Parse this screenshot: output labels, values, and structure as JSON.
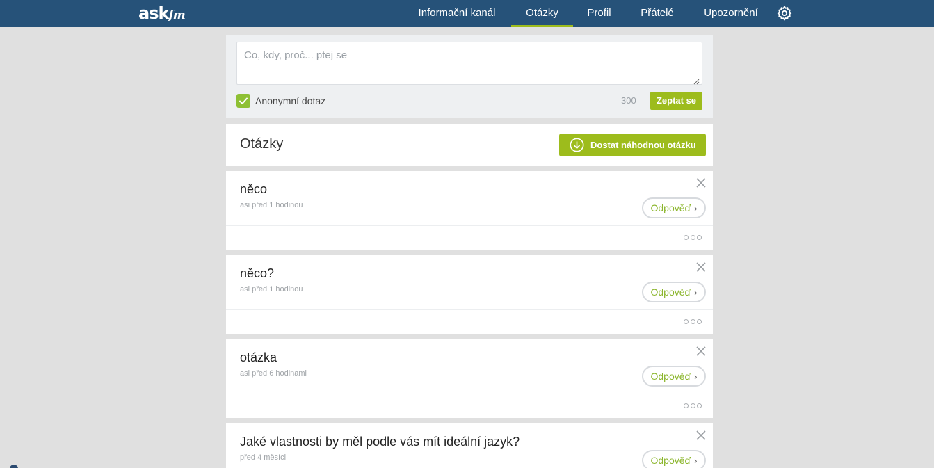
{
  "brand": {
    "ask": "ASK",
    "fm": "fm"
  },
  "nav": {
    "items": [
      {
        "label": "Informační kanál",
        "active": false
      },
      {
        "label": "Otázky",
        "active": true
      },
      {
        "label": "Profil",
        "active": false
      },
      {
        "label": "Přátelé",
        "active": false
      },
      {
        "label": "Upozornění",
        "active": false
      }
    ],
    "settings_icon": "gear-icon"
  },
  "ask_box": {
    "placeholder": "Co, kdy, proč... ptej se",
    "value": "",
    "anonymous_label": "Anonymní dotaz",
    "anonymous_checked": true,
    "char_counter": "300",
    "submit_label": "Zeptat se"
  },
  "questions_section": {
    "title": "Otázky",
    "random_button_label": "Dostat náhodnou otázku"
  },
  "questions": [
    {
      "text": "něco",
      "time": "asi před 1 hodinou",
      "answer_label": "Odpověď"
    },
    {
      "text": "něco?",
      "time": "asi před 1 hodinou",
      "answer_label": "Odpověď"
    },
    {
      "text": "otázka",
      "time": "asi před 6 hodinami",
      "answer_label": "Odpověď"
    },
    {
      "text": "Jaké vlastnosti by měl podle vás mít ideální jazyk?",
      "time": "před 4 měsíci",
      "answer_label": "Odpověď"
    }
  ],
  "colors": {
    "topbar": "#265279",
    "accent_green": "#9dbc1c",
    "page_bg": "#e0e0e0"
  }
}
